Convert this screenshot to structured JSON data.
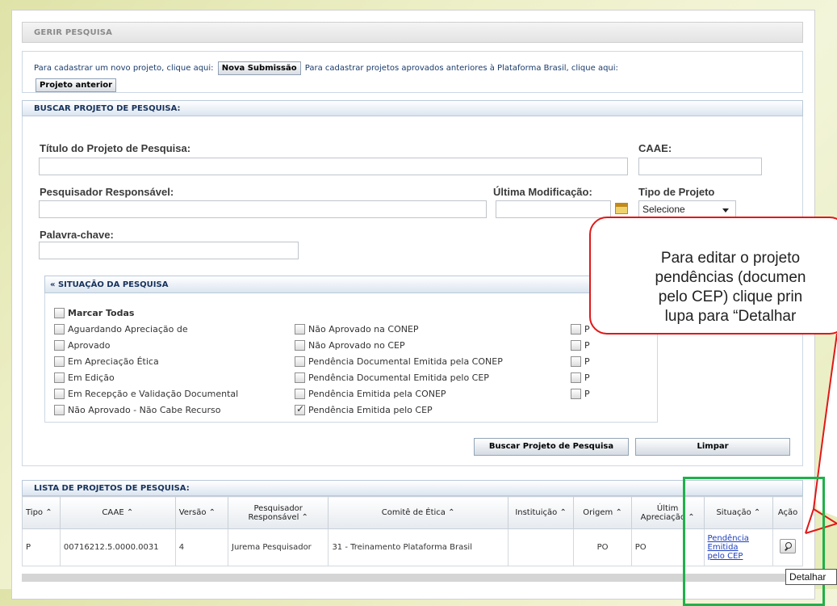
{
  "header": {
    "title": "GERIR PESQUISA"
  },
  "submission": {
    "text1": "Para cadastrar um novo projeto, clique aqui:",
    "new_button": "Nova Submissão",
    "text2": "Para cadastrar projetos aprovados anteriores à Plataforma Brasil, clique aqui:",
    "previous_button": "Projeto anterior"
  },
  "search": {
    "section_title": "BUSCAR PROJETO DE PESQUISA:",
    "title_label": "Título do Projeto de Pesquisa:",
    "caae_label": "CAAE:",
    "researcher_label": "Pesquisador Responsável:",
    "last_mod_label": "Última Modificação:",
    "type_label": "Tipo de Projeto",
    "type_value": "Selecione",
    "keyword_label": "Palavra-chave:",
    "search_button": "Buscar Projeto de Pesquisa",
    "clear_button": "Limpar"
  },
  "situation": {
    "title": "« SITUAÇÃO DA PESQUISA",
    "mark_all": "Marcar Todas",
    "col1": [
      "Aguardando Apreciação de",
      "Aprovado",
      "Em Apreciação Ética",
      "Em Edição",
      "Em Recepção e Validação Documental",
      "Não Aprovado - Não Cabe Recurso"
    ],
    "col2": [
      "Não Aprovado na CONEP",
      "Não Aprovado no CEP",
      "Pendência Documental Emitida pela CONEP",
      "Pendência Documental Emitida pelo CEP",
      "Pendência Emitida pela CONEP",
      "Pendência Emitida pelo CEP"
    ],
    "col3_prefix": [
      "P",
      "P",
      "P",
      "P",
      "P"
    ]
  },
  "results": {
    "section_title": "LISTA DE PROJETOS DE PESQUISA:",
    "columns": {
      "tipo": "Tipo ⌃",
      "caae": "CAAE ⌃",
      "versao": "Versão ⌃",
      "pesq1": "Pesquisador",
      "pesq2": "Responsável ⌃",
      "comite": "Comitê de Ética ⌃",
      "inst": "Instituição ⌃",
      "origem": "Origem ⌃",
      "ultima1": "Últim",
      "ultima2": "Apreciação ⌃",
      "situacao": "Situação ⌃",
      "acao": "Ação"
    },
    "row": {
      "tipo": "P",
      "caae": "00716212.5.0000.0031",
      "versao": "4",
      "pesquisador": "Jurema Pesquisador",
      "comite": "31 - Treinamento Plataforma Brasil",
      "instituicao": "",
      "origem": "PO",
      "ultima": "PO",
      "situacao1": "Pendência",
      "situacao2": "Emitida",
      "situacao3": "pelo CEP"
    }
  },
  "tooltip": "Detalhar",
  "callout": {
    "line1": "Para editar o projeto",
    "line2": "pendências (documen",
    "line3": "pelo CEP) clique prin",
    "line4": "lupa para “Detalhar"
  }
}
